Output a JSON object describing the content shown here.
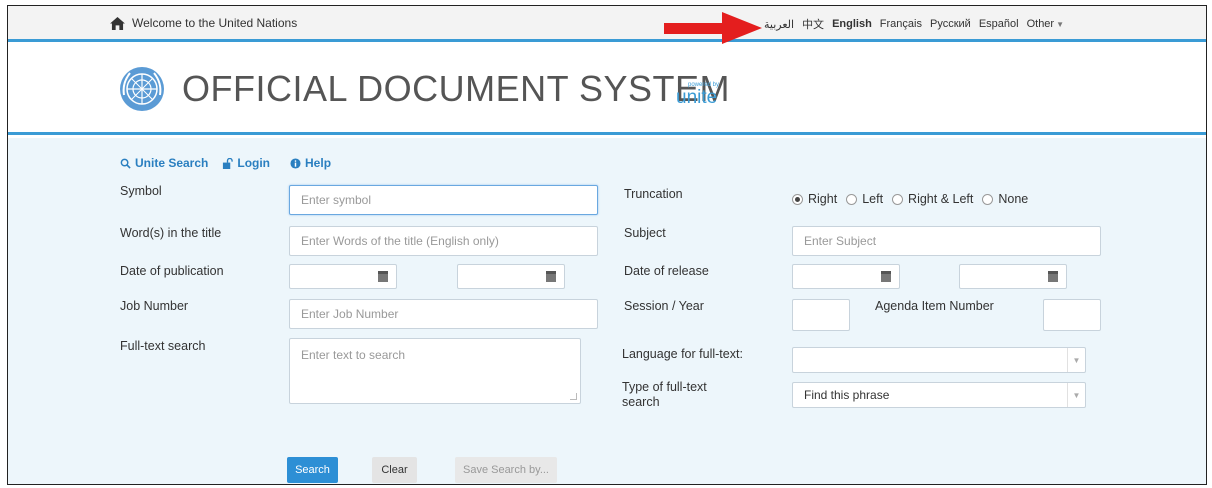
{
  "topbar": {
    "welcome": "Welcome to the United Nations",
    "languages": [
      "العربية",
      "中文",
      "English",
      "Français",
      "Русский",
      "Español",
      "Other"
    ],
    "active_language": "English"
  },
  "header": {
    "title": "OFFICIAL DOCUMENT SYSTEM",
    "powered_by": "powered by",
    "unite": "unite"
  },
  "links": {
    "unite_search": "Unite Search",
    "login": "Login",
    "help": "Help"
  },
  "form": {
    "symbol": {
      "label": "Symbol",
      "placeholder": "Enter symbol"
    },
    "title": {
      "label": "Word(s) in the title",
      "placeholder": "Enter Words of the title (English only)"
    },
    "date_publication": {
      "label": "Date of publication"
    },
    "job_number": {
      "label": "Job Number",
      "placeholder": "Enter Job Number"
    },
    "fulltext": {
      "label": "Full-text search",
      "placeholder": "Enter text to search"
    },
    "truncation": {
      "label": "Truncation",
      "options": [
        "Right",
        "Left",
        "Right & Left",
        "None"
      ],
      "selected": "Right"
    },
    "subject": {
      "label": "Subject",
      "placeholder": "Enter Subject"
    },
    "date_release": {
      "label": "Date of release"
    },
    "session_year": {
      "label": "Session / Year"
    },
    "agenda_item": {
      "label": "Agenda Item Number"
    },
    "fulltext_language": {
      "label": "Language for full-text:",
      "value": ""
    },
    "fulltext_type": {
      "label": "Type of full-text search",
      "value": "Find this phrase"
    }
  },
  "buttons": {
    "search": "Search",
    "clear": "Clear",
    "save": "Save Search by..."
  },
  "colors": {
    "accent": "#3a9bd5",
    "main_bg": "#edf6fb",
    "search_button": "#2d8fd5",
    "arrow": "#e41e1e"
  }
}
